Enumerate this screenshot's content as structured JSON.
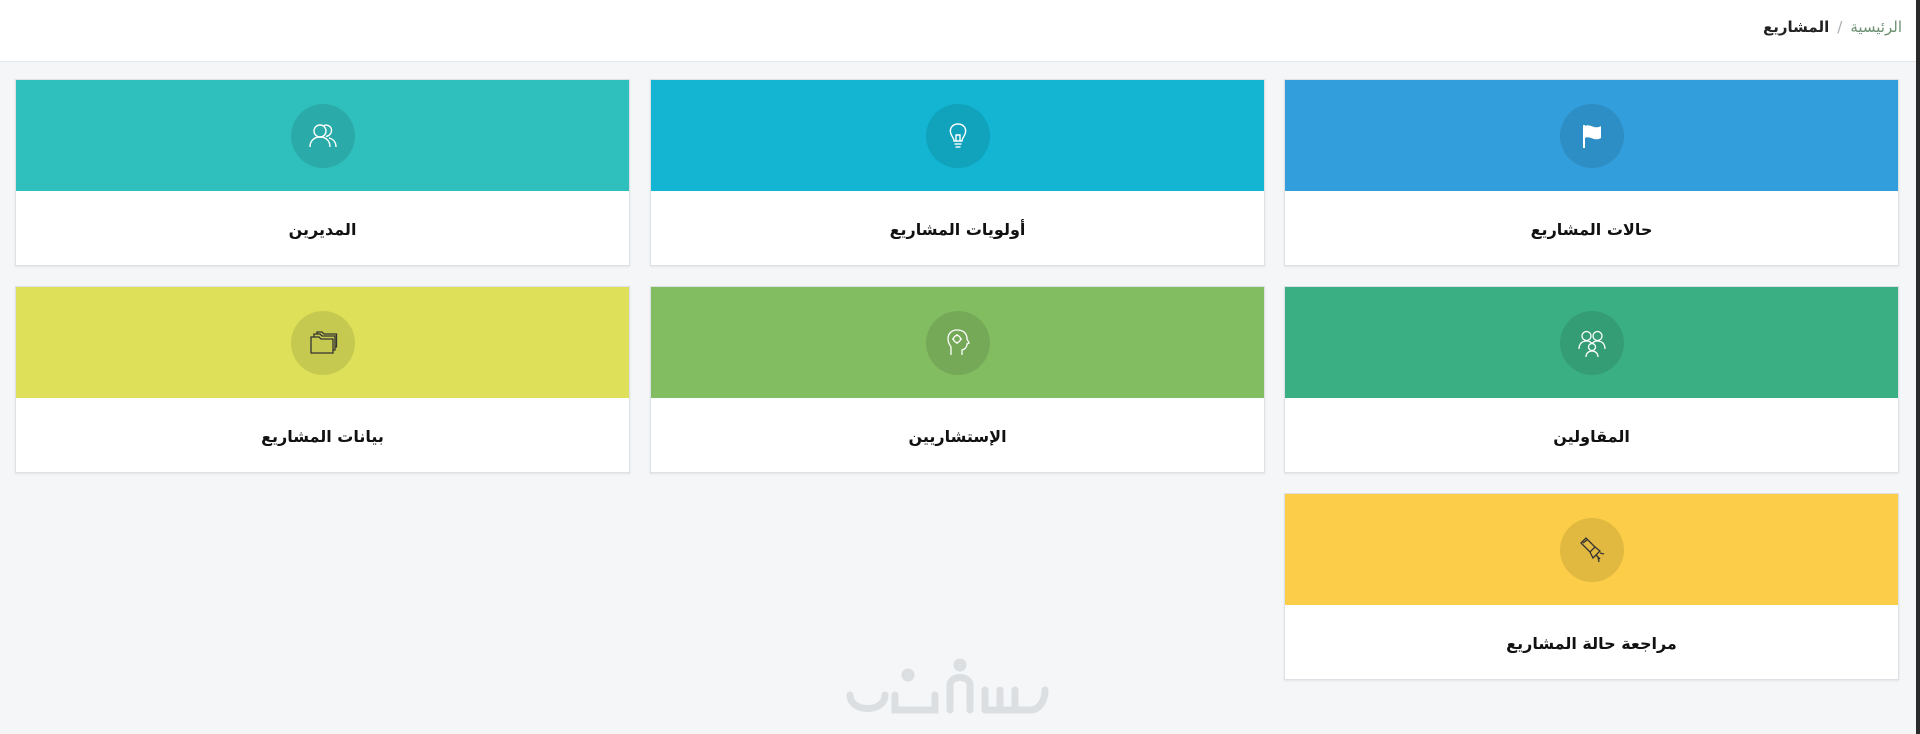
{
  "breadcrumb": {
    "home": "الرئيسية",
    "separator": "/",
    "current": "المشاريع"
  },
  "cards": [
    {
      "label": "حالات المشاريع",
      "color": "#339edc",
      "icon": "flag-icon"
    },
    {
      "label": "أولويات المشاريع",
      "color": "#13b5d2",
      "icon": "lightbulb-icon"
    },
    {
      "label": "المديرين",
      "color": "#2fbfbd",
      "icon": "users-icon"
    },
    {
      "label": "المقاولين",
      "color": "#3baf84",
      "icon": "contractors-icon"
    },
    {
      "label": "الإستشاريين",
      "color": "#83bd61",
      "icon": "consultant-head-icon"
    },
    {
      "label": "بيانات المشاريع",
      "color": "#dde058",
      "icon": "folders-icon"
    },
    {
      "label": "مراجعة حالة المشاريع",
      "color": "#fbcd48",
      "icon": "flashlight-icon"
    }
  ]
}
